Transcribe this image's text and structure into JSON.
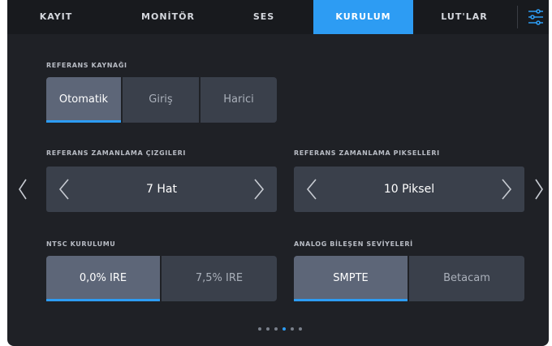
{
  "tabs": [
    {
      "label": "KAYIT",
      "active": false
    },
    {
      "label": "MONİTÖR",
      "active": false
    },
    {
      "label": "SES",
      "active": false
    },
    {
      "label": "KURULUM",
      "active": true
    },
    {
      "label": "LUT'LAR",
      "active": false
    }
  ],
  "settings_icon": "sliders-icon",
  "reference_source": {
    "label": "REFERANS KAYNAĞI",
    "options": [
      "Otomatik",
      "Giriş",
      "Harici"
    ],
    "selected": "Otomatik"
  },
  "timing_lines": {
    "label": "REFERANS ZAMANLAMA ÇIZGILERI",
    "value": "7 Hat"
  },
  "timing_pixels": {
    "label": "REFERANS ZAMANLAMA PIKSELLERI",
    "value": "10 Piksel"
  },
  "ntsc_setup": {
    "label": "NTSC KURULUMU",
    "options": [
      "0,0% IRE",
      "7,5% IRE"
    ],
    "selected": "0,0% IRE"
  },
  "analog_levels": {
    "label": "ANALOG BİLEŞEN SEVİYELERİ",
    "options": [
      "SMPTE",
      "Betacam"
    ],
    "selected": "SMPTE"
  },
  "pagination": {
    "count": 6,
    "active_index": 3
  },
  "colors": {
    "accent": "#2d9cf3",
    "panel": "#1f2126",
    "button": "#3a404b",
    "button_selected": "#5d6678"
  }
}
